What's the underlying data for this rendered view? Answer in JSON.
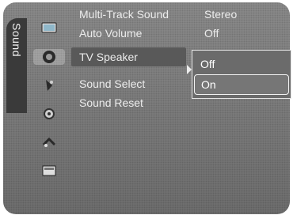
{
  "side_tab": {
    "label": "Sound"
  },
  "icons": [
    "picture-icon",
    "sound-icon",
    "channel-icon",
    "setup-icon",
    "input-icon",
    "application-icon"
  ],
  "menu": {
    "rows": [
      {
        "label": "Multi-Track Sound",
        "value": "Stereo"
      },
      {
        "label": "Auto Volume",
        "value": "Off"
      },
      {
        "label": "TV Speaker",
        "value": ""
      },
      {
        "label": "Sound Select",
        "value": ""
      },
      {
        "label": "Sound Reset",
        "value": ""
      }
    ]
  },
  "popup": {
    "options": [
      "Off",
      "On"
    ],
    "selected": "On"
  }
}
